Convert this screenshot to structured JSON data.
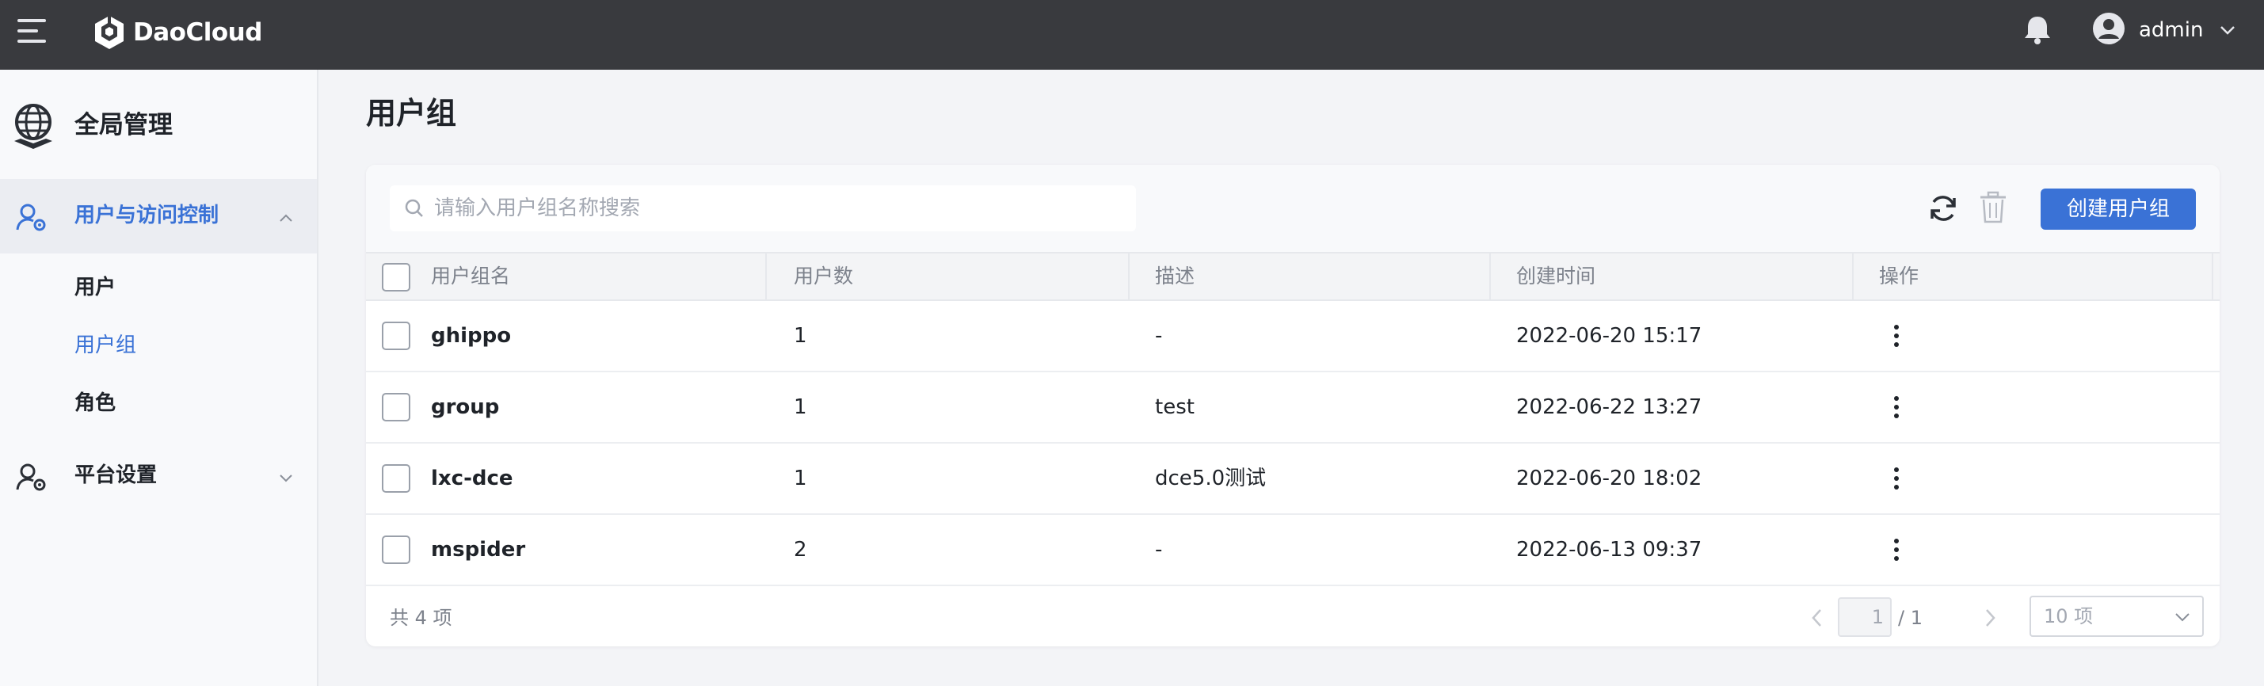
{
  "header": {
    "brand": "DaoCloud",
    "username": "admin"
  },
  "sidebar": {
    "title": "全局管理",
    "groups": [
      {
        "label": "用户与访问控制",
        "expanded": true
      },
      {
        "label": "平台设置",
        "expanded": false
      }
    ],
    "items": [
      {
        "label": "用户"
      },
      {
        "label": "用户组",
        "active": true
      },
      {
        "label": "角色"
      }
    ]
  },
  "page": {
    "title": "用户组"
  },
  "toolbar": {
    "search_placeholder": "请输入用户组名称搜索",
    "create_label": "创建用户组"
  },
  "table": {
    "columns": [
      "用户组名",
      "用户数",
      "描述",
      "创建时间",
      "操作"
    ],
    "rows": [
      {
        "name": "ghippo",
        "users": "1",
        "description": "-",
        "created": "2022-06-20 15:17"
      },
      {
        "name": "group",
        "users": "1",
        "description": "test",
        "created": "2022-06-22 13:27"
      },
      {
        "name": "lxc-dce",
        "users": "1",
        "description": "dce5.0测试",
        "created": "2022-06-20 18:02"
      },
      {
        "name": "mspider",
        "users": "2",
        "description": "-",
        "created": "2022-06-13 09:37"
      }
    ]
  },
  "pagination": {
    "total": "共 4 项",
    "current": "1",
    "pages": "/ 1",
    "page_size": "10 项"
  },
  "colors": {
    "topbar": "#393a3e",
    "primary": "#3a72d6",
    "sidebar_active_bg": "#ebedf2"
  }
}
